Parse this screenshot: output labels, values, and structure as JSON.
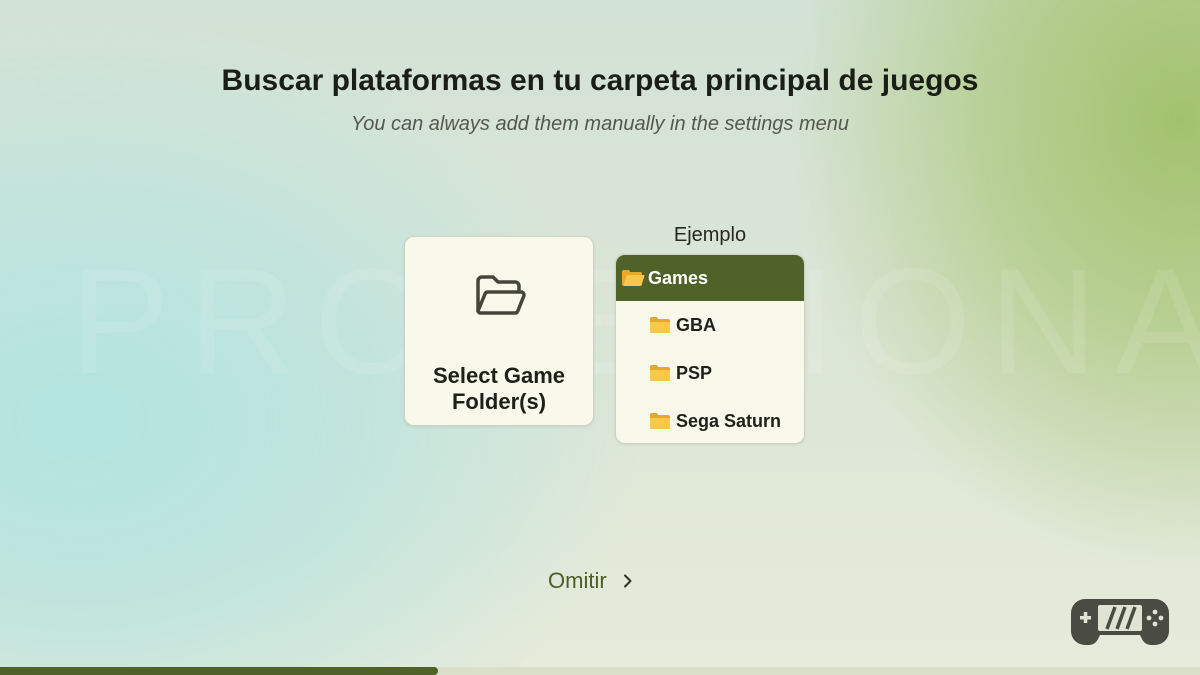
{
  "header": {
    "title": "Buscar plataformas en tu carpeta principal de juegos",
    "subtitle": "You can always add them manually in the settings menu"
  },
  "select_folder": {
    "label": "Select Game Folder(s)",
    "icon": "folder-open-outline-icon"
  },
  "example": {
    "label": "Ejemplo",
    "root": "Games",
    "root_icon": "open-folder-icon",
    "items": [
      {
        "label": "GBA",
        "icon": "folder-icon"
      },
      {
        "label": "PSP",
        "icon": "folder-icon"
      },
      {
        "label": "Sega Saturn",
        "icon": "folder-icon"
      }
    ]
  },
  "footer": {
    "skip_label": "Omitir",
    "skip_icon": "chevron-right-icon",
    "logo_icon": "handheld-controller-icon"
  },
  "progress": {
    "fraction": 0.365
  },
  "colors": {
    "accent": "#4f6227",
    "card_bg": "#f8f9ea",
    "folder_yellow": "#f7c84a",
    "skip_text": "#4d5d28"
  }
}
